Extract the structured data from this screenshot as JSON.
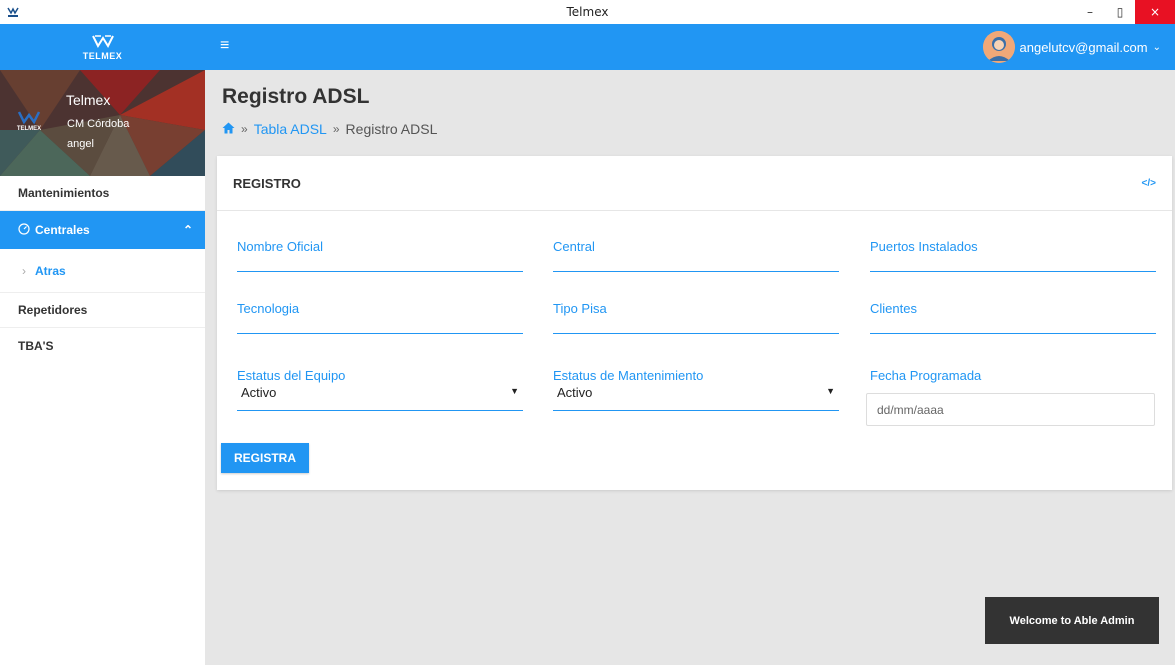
{
  "window": {
    "title": "Telmex",
    "minimize": "–",
    "maximize": "▯",
    "close": "×"
  },
  "header": {
    "brand_text": "TELMEX",
    "menu_glyph": "≡",
    "user_email": "angelutcv@gmail.com",
    "user_chevron": "⌄"
  },
  "profile": {
    "name": "Telmex",
    "org": "CM Córdoba",
    "user": "angel",
    "logo_text": "TELMEX"
  },
  "sidebar": {
    "items": [
      {
        "label": "Mantenimientos"
      },
      {
        "label": "Centrales",
        "icon": "gauge-icon",
        "active": true,
        "caret": "⌃"
      },
      {
        "label": "Atras",
        "sub": true,
        "arrow": "›"
      },
      {
        "label": "Repetidores"
      },
      {
        "label": "TBA'S"
      }
    ]
  },
  "page": {
    "title": "Registro ADSL",
    "breadcrumb": {
      "home_icon": "home-icon",
      "sep": "»",
      "link": "Tabla ADSL",
      "current": "Registro ADSL"
    }
  },
  "form": {
    "card_title": "REGISTRO",
    "code_glyph": "</>",
    "fields": {
      "nombre_oficial": "Nombre Oficial",
      "central": "Central",
      "puertos": "Puertos Instalados",
      "tecnologia": "Tecnologia",
      "tipo_pisa": "Tipo Pisa",
      "clientes": "Clientes"
    },
    "estatus_equipo": {
      "label": "Estatus del Equipo",
      "value": "Activo",
      "arrow": "▼"
    },
    "estatus_mant": {
      "label": "Estatus de Mantenimiento",
      "value": "Activo",
      "arrow": "▼"
    },
    "fecha": {
      "label": "Fecha Programada",
      "placeholder": "dd/mm/aaaa"
    },
    "submit_label": "REGISTRA"
  },
  "toast": {
    "message": "Welcome to Able Admin"
  },
  "colors": {
    "accent": "#2196f3",
    "toast_bg": "#333333",
    "close": "#e81123"
  }
}
